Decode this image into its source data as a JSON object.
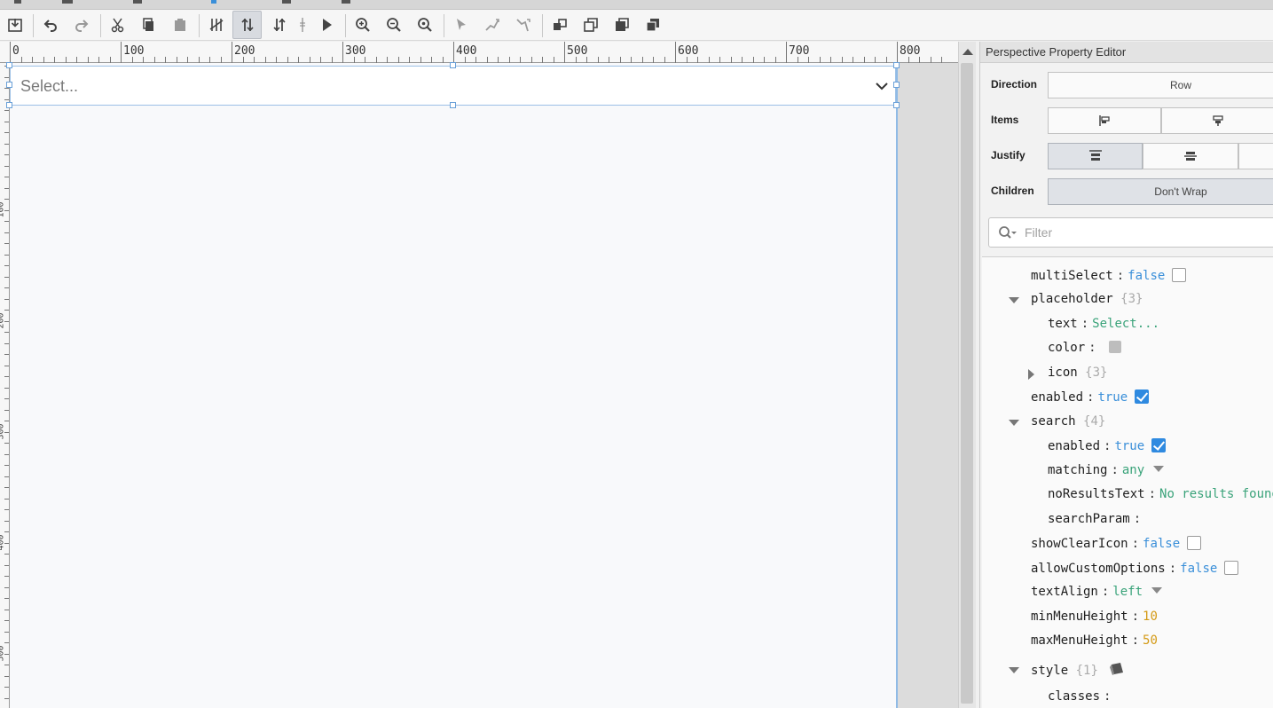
{
  "toolbar": {
    "buttons": [
      "save-icon",
      "undo-icon",
      "redo-icon",
      "cut-icon",
      "copy-icon",
      "paste-icon",
      "snap-icon",
      "layout-mode-icon",
      "vertical-layout-icon",
      "split-icon",
      "play-icon",
      "zoom-in-icon",
      "zoom-out-icon",
      "zoom-fit-icon",
      "select-pointer-icon",
      "connector-icon",
      "connector-2-icon",
      "group-icon",
      "ungroup-icon",
      "bring-front-icon",
      "send-back-icon"
    ]
  },
  "ruler": {
    "labels": [
      "0",
      "100",
      "200",
      "300",
      "400",
      "500",
      "600",
      "700",
      "800"
    ],
    "left_labels": [
      "100",
      "200",
      "300",
      "400",
      "500"
    ]
  },
  "canvas": {
    "dropdown_placeholder": "Select..."
  },
  "panel": {
    "title": "Perspective Property Editor",
    "direction": {
      "label": "Direction",
      "value": "Row"
    },
    "items": {
      "label": "Items"
    },
    "justify": {
      "label": "Justify"
    },
    "children": {
      "label": "Children",
      "value": "Don't Wrap"
    },
    "filter_placeholder": "Filter"
  },
  "props": {
    "multiSelect": {
      "key": "multiSelect",
      "value": "false"
    },
    "placeholder": {
      "key": "placeholder",
      "count": "{3}"
    },
    "placeholder_text": {
      "key": "text",
      "value": "Select..."
    },
    "placeholder_color": {
      "key": "color"
    },
    "placeholder_icon": {
      "key": "icon",
      "count": "{3}"
    },
    "enabled": {
      "key": "enabled",
      "value": "true"
    },
    "search": {
      "key": "search",
      "count": "{4}"
    },
    "search_enabled": {
      "key": "enabled",
      "value": "true"
    },
    "search_matching": {
      "key": "matching",
      "value": "any"
    },
    "search_noResultsText": {
      "key": "noResultsText",
      "value": "No results found"
    },
    "search_searchParam": {
      "key": "searchParam"
    },
    "showClearIcon": {
      "key": "showClearIcon",
      "value": "false"
    },
    "allowCustomOptions": {
      "key": "allowCustomOptions",
      "value": "false"
    },
    "textAlign": {
      "key": "textAlign",
      "value": "left"
    },
    "minMenuHeight": {
      "key": "minMenuHeight",
      "value": "10"
    },
    "maxMenuHeight": {
      "key": "maxMenuHeight",
      "value": "50"
    },
    "style": {
      "key": "style",
      "count": "{1}"
    },
    "style_classes": {
      "key": "classes"
    }
  },
  "colors": {
    "accent": "#2f8ae0",
    "bool": "#3a8fd9",
    "string": "#3aa37a",
    "number": "#d49a16"
  }
}
